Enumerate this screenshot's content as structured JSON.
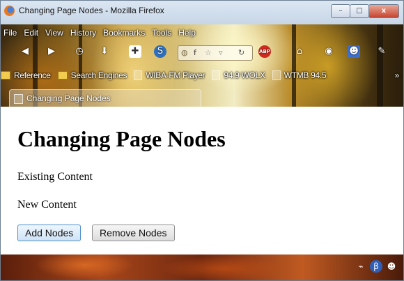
{
  "window": {
    "title": "Changing Page Nodes - Mozilla Firefox",
    "buttons": {
      "minimize": "–",
      "maximize": "□",
      "close": "x"
    }
  },
  "menu": [
    "File",
    "Edit",
    "View",
    "History",
    "Bookmarks",
    "Tools",
    "Help"
  ],
  "toolbar": {
    "url_text": "f",
    "icons": [
      "back-icon",
      "forward-icon",
      "clock-icon",
      "download-icon",
      "save-icon",
      "s-logo-icon",
      "adblock-icon",
      "home-icon",
      "eye-icon",
      "robot-icon",
      "wrench-icon"
    ],
    "adblock_label": "ABP"
  },
  "bookmarks": [
    "Reference",
    "Search Engines",
    "WIBA-FM Player",
    "94.9 WOLX",
    "WTMB 94.5"
  ],
  "bookmarks_overflow": "»",
  "tab": {
    "label": "Changing Page Nodes"
  },
  "page": {
    "heading": "Changing Page Nodes",
    "paragraphs": [
      "Existing Content",
      "New Content"
    ],
    "buttons": {
      "add": "Add Nodes",
      "remove": "Remove Nodes"
    }
  }
}
